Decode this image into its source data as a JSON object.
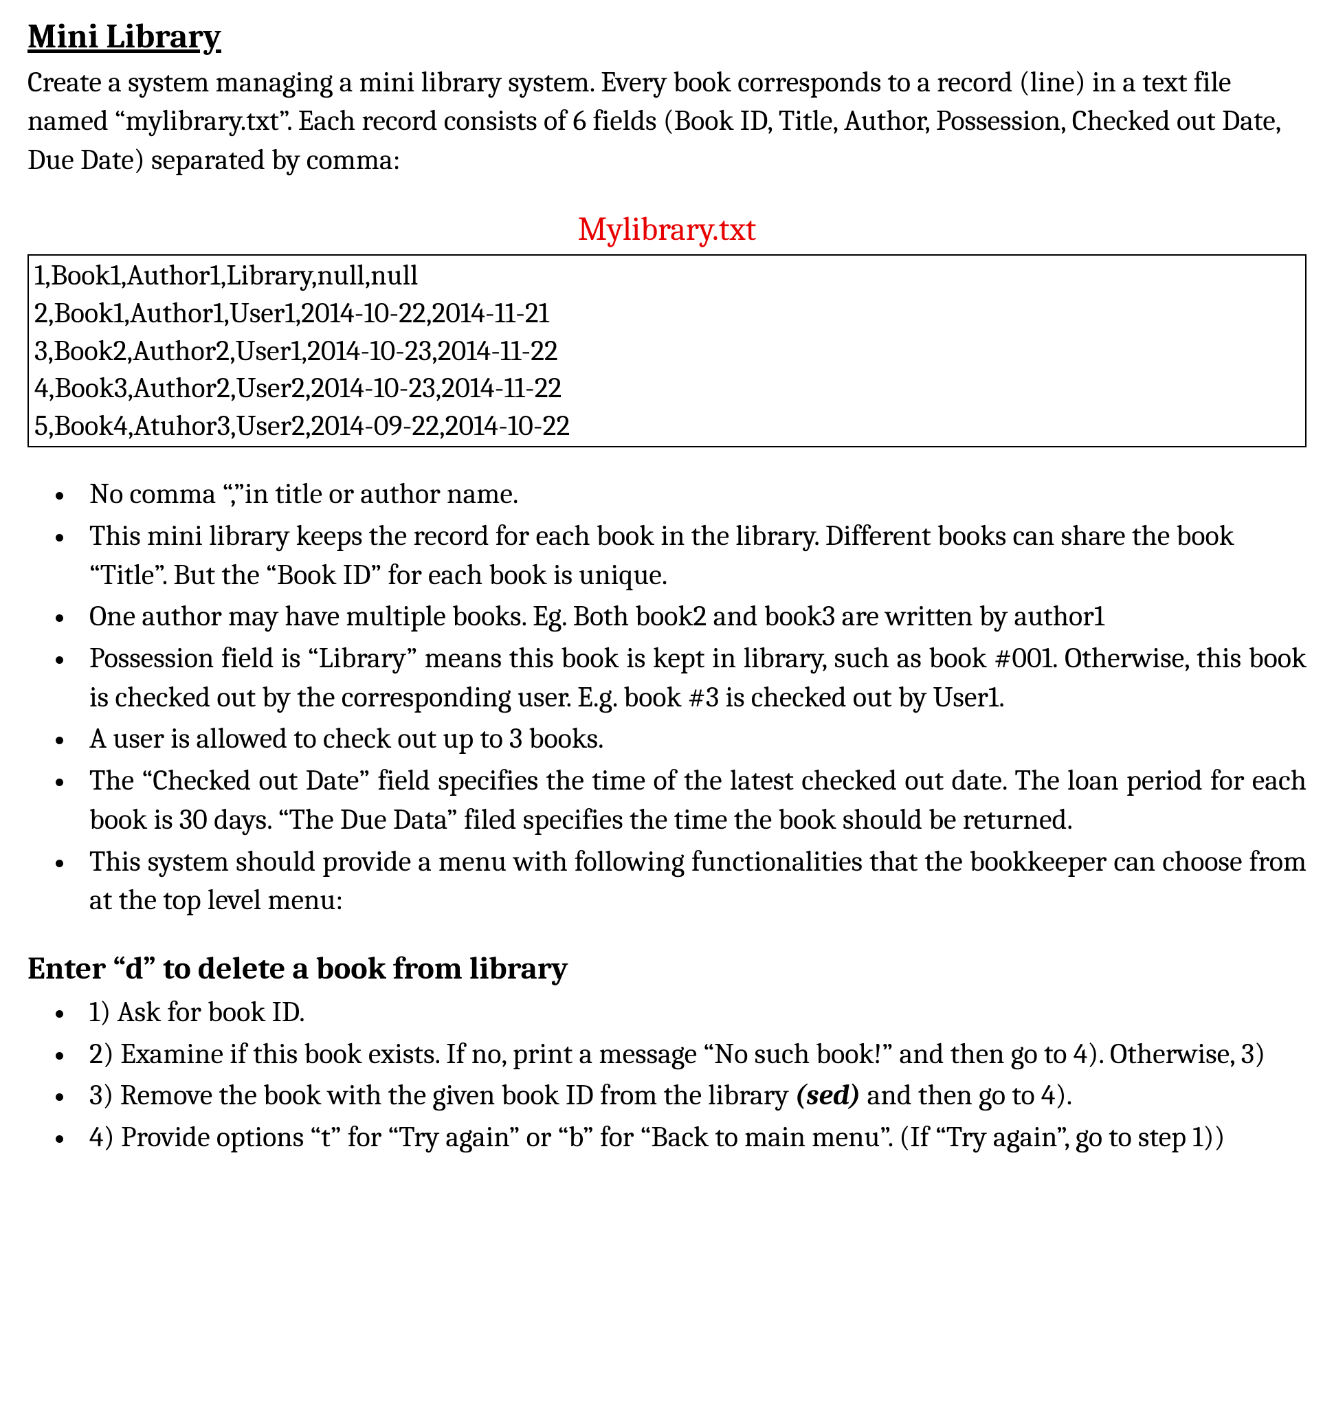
{
  "title": "Mini Library",
  "intro": "Create a system managing a mini library system.   Every book corresponds to a record (line) in a text file named “mylibrary.txt”. Each record consists of 6 fields (Book ID, Title, Author, Possession, Checked out Date, Due Date) separated by comma:",
  "file_title": "Mylibrary.txt",
  "file_lines": [
    "1,Book1,Author1,Library,null,null",
    "2,Book1,Author1,User1,2014-10-22,2014-11-21",
    "3,Book2,Author2,User1,2014-10-23,2014-11-22",
    "4,Book3,Author2,User2,2014-10-23,2014-11-22",
    "5,Book4,Atuhor3,User2,2014-09-22,2014-10-22"
  ],
  "rules": [
    "No comma “,”in title or author name.",
    "This mini library keeps the record for each book in the library. Different books can share the book “Title”. But the “Book ID” for each book is unique.",
    "One author may have multiple books. Eg. Both book2 and book3 are written by author1",
    "Possession field is “Library” means this book is kept in library, such as book #001.   Otherwise, this book is checked out by the corresponding user. E.g. book #3 is checked out by User1.",
    "A user is allowed to check out up to 3 books.",
    "The “Checked out Date” field specifies the time of the latest checked out date. The loan period for each book is 30 days. “The Due Data” filed specifies the time the book should be returned.",
    "This system should provide a menu with following functionalities that the bookkeeper can choose from at the top level menu:"
  ],
  "section_heading": "Enter “d” to delete a book from library",
  "steps": {
    "s1": "1) Ask for book ID.",
    "s2": "2) Examine if this book exists. If no, print a message “No such book!” and then go to 4). Otherwise, 3)",
    "s3_a": "3) Remove the book with the given book ID from the library ",
    "s3_sed": "(sed)",
    "s3_b": " and then go to 4).",
    "s4": "4) Provide options “t” for “Try again” or “b” for “Back to main menu”. (If “Try again”, go to step 1))"
  }
}
